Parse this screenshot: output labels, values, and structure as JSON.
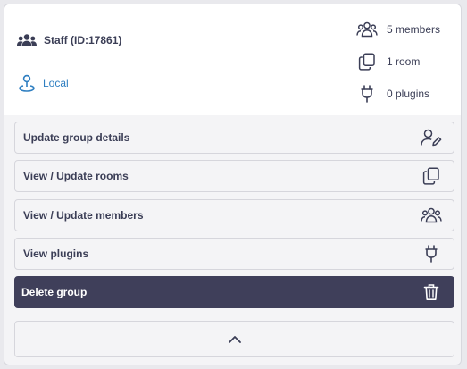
{
  "group": {
    "name": "Staff (ID:17861)",
    "location": "Local"
  },
  "stats": {
    "members": "5 members",
    "rooms": "1 room",
    "plugins": "0 plugins"
  },
  "actions": {
    "update_details": "Update group details",
    "update_rooms": "View / Update rooms",
    "update_members": "View / Update members",
    "view_plugins": "View plugins",
    "delete_group": "Delete group"
  },
  "colors": {
    "text": "#3b3e56",
    "link": "#2f7fc1",
    "danger_bg": "#3f3f5a",
    "card_bg": "#f4f4f6"
  },
  "icons": {
    "group": "users-icon",
    "location": "location-pin-icon",
    "members": "users-icon",
    "rooms": "copy-icon",
    "plugins": "plug-icon",
    "edit": "user-edit-icon",
    "delete": "trash-icon",
    "collapse": "chevron-up-icon"
  }
}
